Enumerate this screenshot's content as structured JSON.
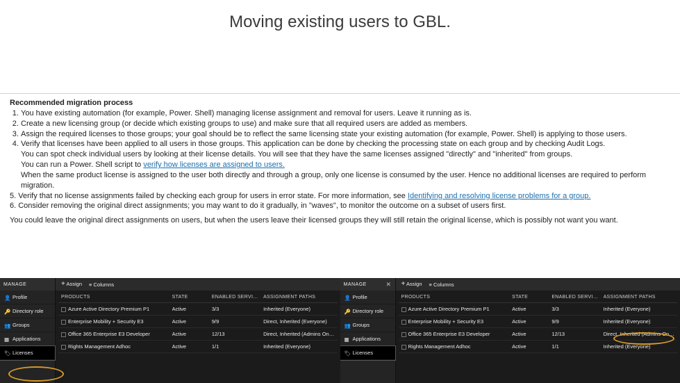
{
  "title": "Moving existing users to GBL.",
  "heading": "Recommended migration process",
  "steps": [
    "You have existing automation (for example, Power. Shell) managing license assignment and removal for users. Leave it running as is.",
    "Create a new licensing group (or decide which existing groups to use) and make sure that all required users are added as members.",
    "Assign the required licenses to those groups; your goal should be to reflect the same licensing state your existing automation (for example, Power. Shell) is applying to those users.",
    "Verify that licenses have been applied to all users in those groups. This application can be done by checking the processing state on each group and by checking Audit Logs."
  ],
  "step4_lines": [
    "You can spot check individual users by looking at their license details. You will see that they have the same licenses assigned \"directly\" and \"inherited\" from groups.",
    "You can run a Power. Shell script to ",
    "When the same product license is assigned to the user both directly and through a group, only one license is consumed by the user. Hence no additional licenses are required to perform migration."
  ],
  "link1": "verify how licenses are assigned to users.",
  "step5_pre": "5. Verify that no license assignments failed by checking each group for users in error state. For more information, see ",
  "link2": "Identifying and resolving license problems for a group.",
  "step6": "6. Consider removing the original direct assignments; you may want to do it gradually, in \"waves\", to monitor the outcome on a subset of users first.",
  "closing": "You could leave the original direct assignments on users, but when the users leave their licensed groups they will still retain the original license, which is possibly not want you want.",
  "panel": {
    "manage": "MANAGE",
    "sidebar": [
      "Profile",
      "Directory role",
      "Groups",
      "Applications",
      "Licenses"
    ],
    "toolbar_assign": "Assign",
    "toolbar_columns": "Columns",
    "headers": [
      "PRODUCTS",
      "STATE",
      "ENABLED SERVICES",
      "ASSIGNMENT PATHS"
    ],
    "rows_left": [
      [
        "Azure Active Directory Premium P1",
        "Active",
        "3/3",
        "Inherited (Everyone)"
      ],
      [
        "Enterprise Mobility + Security E3",
        "Active",
        "9/9",
        "Direct, Inherited (Everyone)"
      ],
      [
        "Office 365 Enterprise E3 Developer",
        "Active",
        "12/13",
        "Direct, Inherited (Admins Only)"
      ],
      [
        "Rights Management Adhoc",
        "Active",
        "1/1",
        "Inherited (Everyone)"
      ]
    ],
    "rows_right": [
      [
        "Azure Active Directory Premium P1",
        "Active",
        "3/3",
        "Inherited (Everyone)"
      ],
      [
        "Enterprise Mobility + Security E3",
        "Active",
        "9/9",
        "Inherited (Everyone)"
      ],
      [
        "Office 365 Enterprise E3 Developer",
        "Active",
        "12/13",
        "Direct, Inherited (Admins Only)"
      ],
      [
        "Rights Management Adhoc",
        "Active",
        "1/1",
        "Inherited (Everyone)"
      ]
    ]
  }
}
